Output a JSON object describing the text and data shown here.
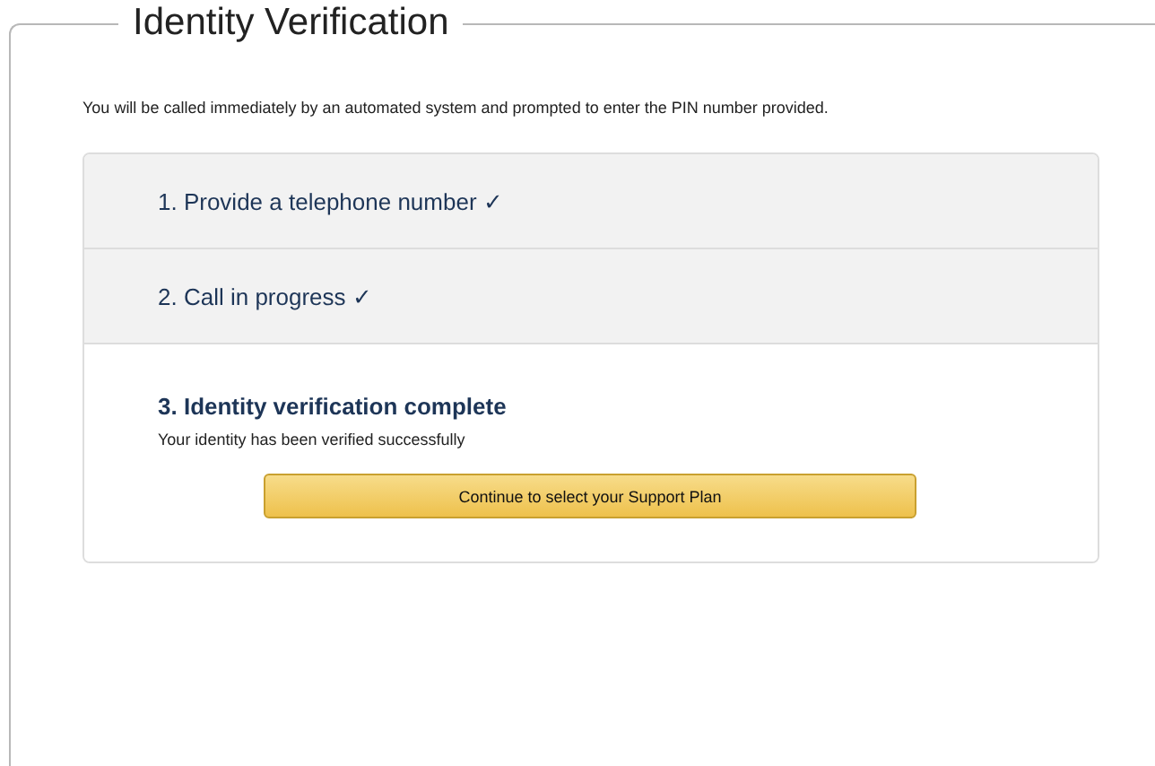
{
  "section": {
    "title": "Identity Verification"
  },
  "intro": "You will be called immediately by an automated system and prompted to enter the PIN number provided.",
  "steps": [
    {
      "title": "1. Provide a telephone number ✓",
      "expanded": false
    },
    {
      "title": "2. Call in progress ✓",
      "expanded": false
    },
    {
      "title": "3. Identity verification complete",
      "expanded": true,
      "message": "Your identity has been verified successfully",
      "button": "Continue to select your Support Plan"
    }
  ]
}
